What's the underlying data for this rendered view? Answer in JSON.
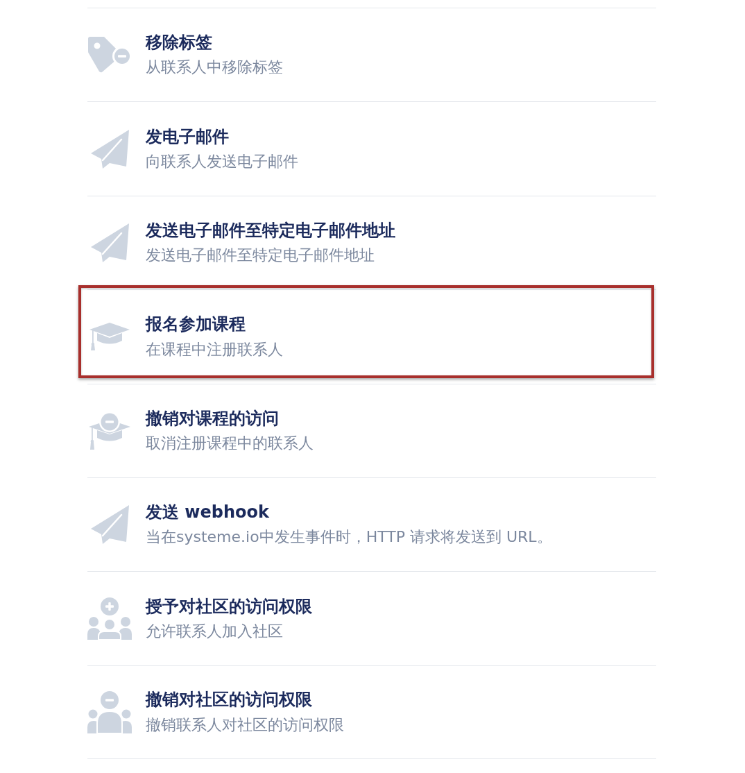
{
  "actions": [
    {
      "kind": "tag_remove",
      "title": "移除标签",
      "description": "从联系人中移除标签",
      "selected": false
    },
    {
      "kind": "send",
      "title": "发电子邮件",
      "description": "向联系人发送电子邮件",
      "selected": false
    },
    {
      "kind": "send",
      "title": "发送电子邮件至特定电子邮件地址",
      "description": "发送电子邮件至特定电子邮件地址",
      "selected": false
    },
    {
      "kind": "course_enroll",
      "title": "报名参加课程",
      "description": "在课程中注册联系人",
      "selected": true
    },
    {
      "kind": "course_revoke",
      "title": "撤销对课程的访问",
      "description": "取消注册课程中的联系人",
      "selected": false
    },
    {
      "kind": "send",
      "title": "发送 webhook",
      "description": "当在systeme.io中发生事件时，HTTP 请求将发送到 URL。",
      "selected": false
    },
    {
      "kind": "community_grant",
      "title": "授予对社区的访问权限",
      "description": "允许联系人加入社区",
      "selected": false
    },
    {
      "kind": "community_revoke",
      "title": "撤销对社区的访问权限",
      "description": "撤销联系人对社区的访问权限",
      "selected": false
    }
  ]
}
